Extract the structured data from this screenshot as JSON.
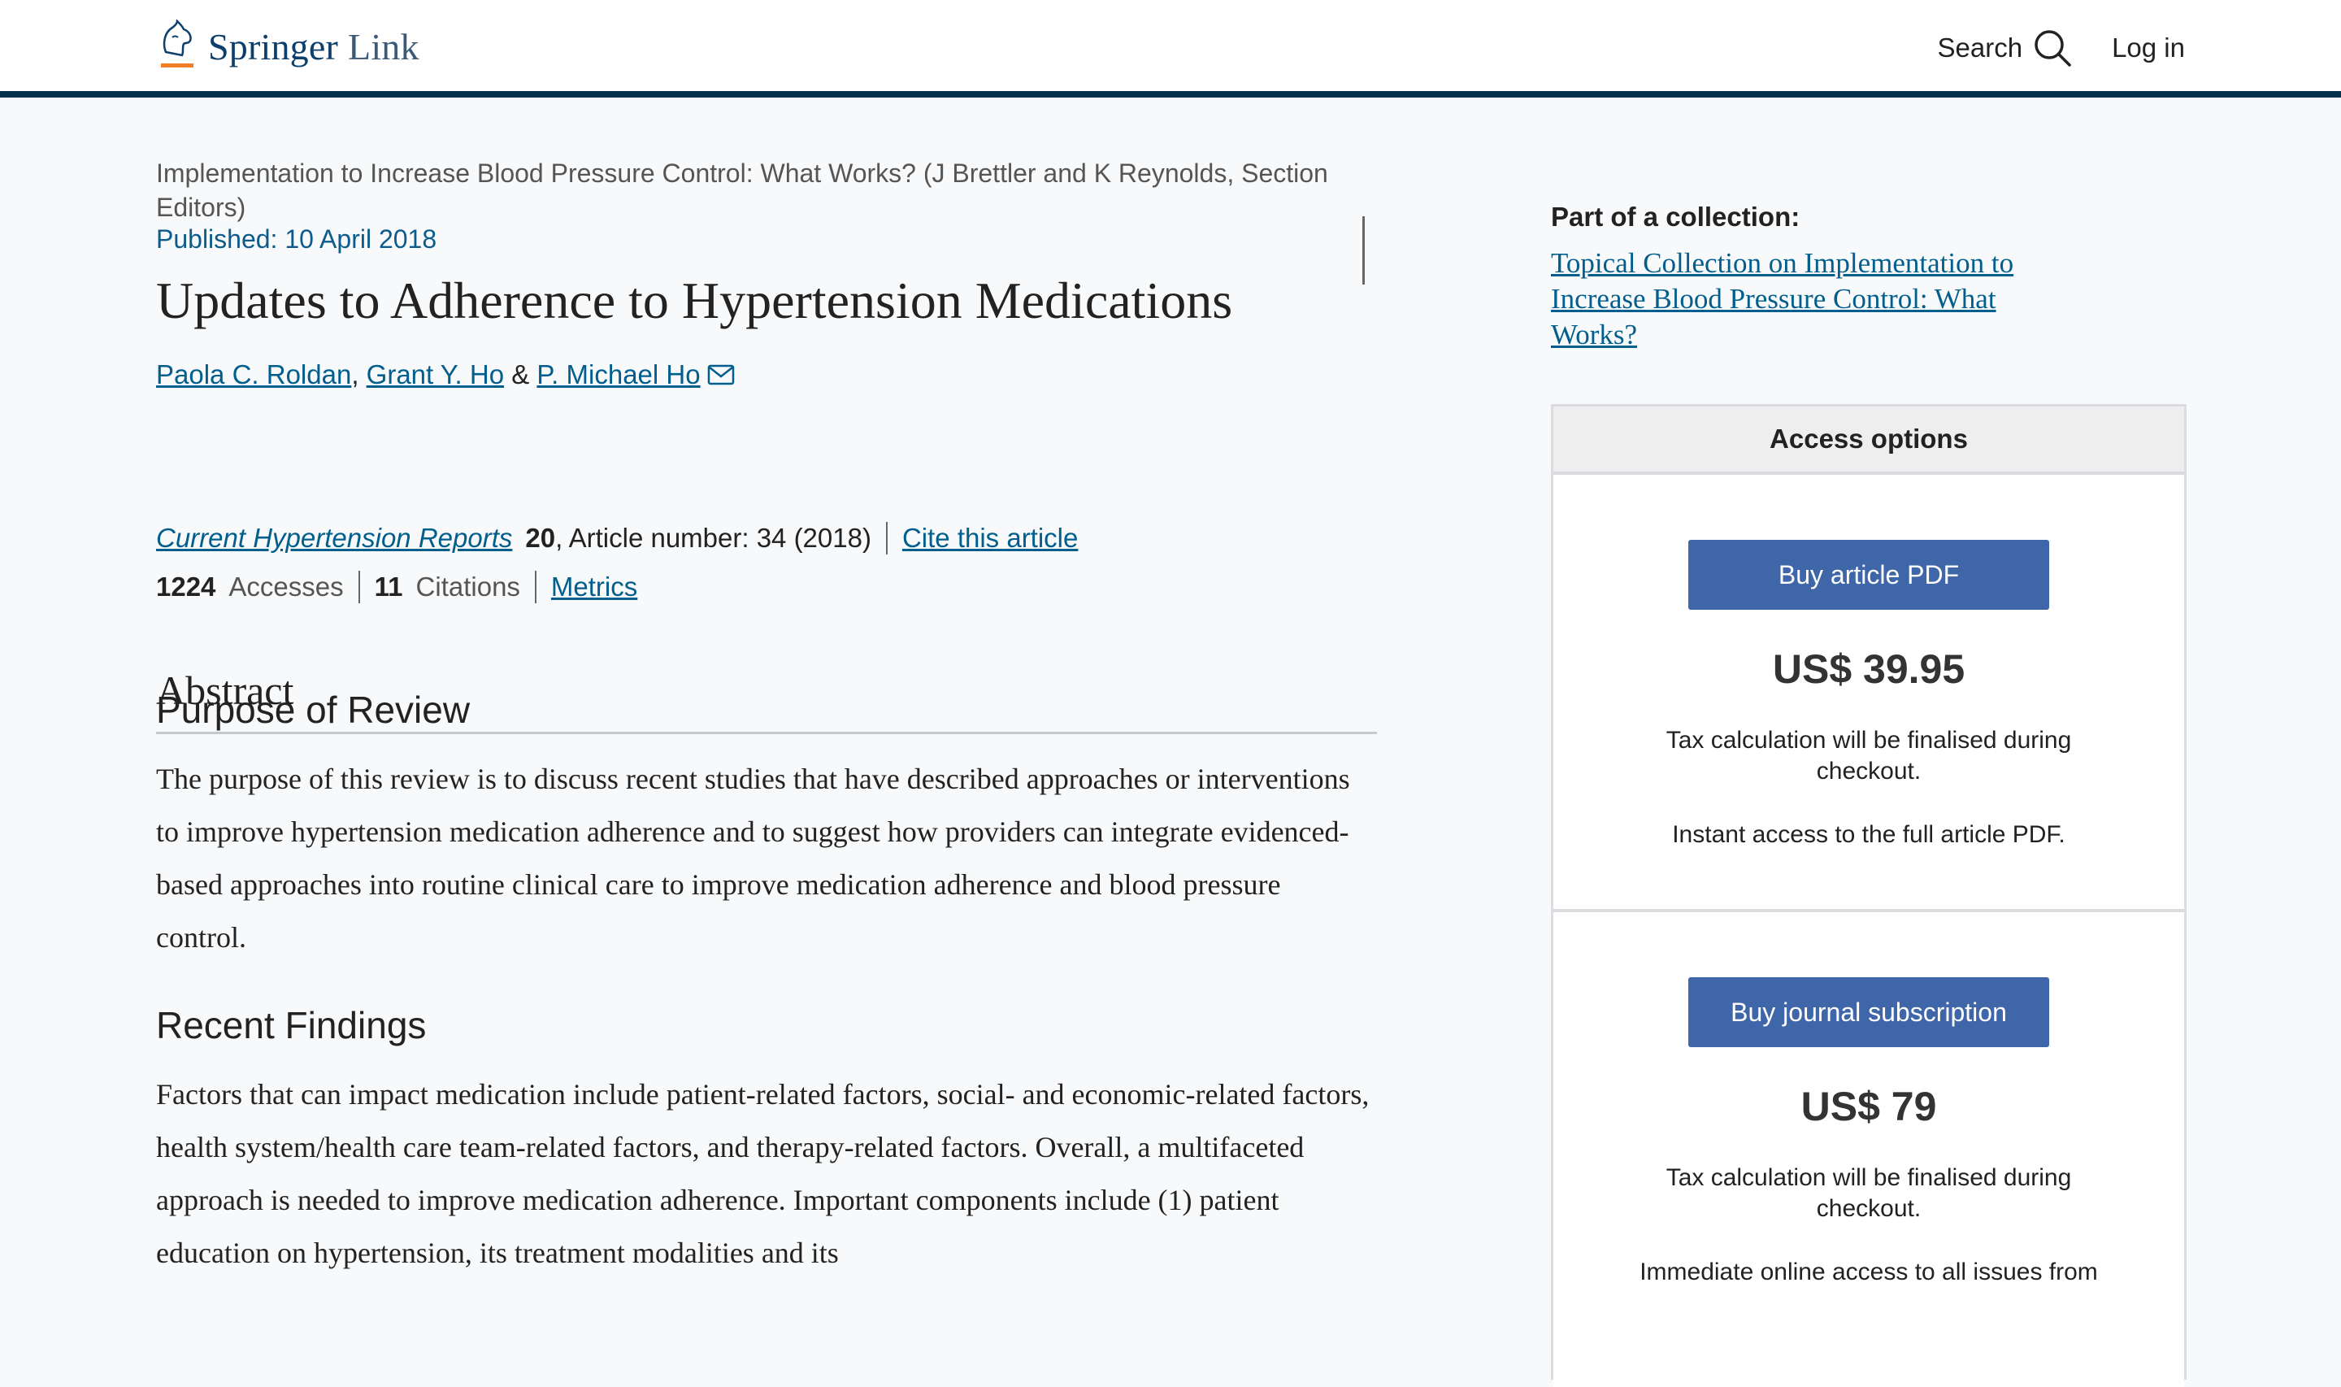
{
  "header": {
    "logo_brand": "Springer",
    "logo_product": "Link",
    "search_label": "Search",
    "login_label": "Log in"
  },
  "article": {
    "collection_line": "Implementation to Increase Blood Pressure Control: What Works? (J Brettler and K Reynolds, Section Editors)",
    "published": "Published: 10 April 2018",
    "title": "Updates to Adherence to Hypertension Medications",
    "authors": [
      {
        "name": "Paola C. Roldan"
      },
      {
        "name": "Grant Y. Ho"
      },
      {
        "name": "P. Michael Ho"
      }
    ],
    "author_sep_1": ",",
    "author_sep_2": "&",
    "journal": "Current Hypertension Reports",
    "volume": "20",
    "article_number": ", Article number: 34 (2018)",
    "cite_label": "Cite this article",
    "accesses_count": "1224",
    "accesses_label": "Accesses",
    "citations_count": "11",
    "citations_label": "Citations",
    "metrics_label": "Metrics"
  },
  "abstract": {
    "heading": "Abstract",
    "purpose_heading": "Purpose of Review",
    "purpose_text": "The purpose of this review is to discuss recent studies that have described approaches or interventions to improve hypertension medication adherence and to suggest how providers can integrate evidenced-based approaches into routine clinical care to improve medication adherence and blood pressure control.",
    "findings_heading": "Recent Findings",
    "findings_text": "Factors that can impact medication include patient-related factors, social- and economic-related factors, health system/health care team-related factors, and therapy-related factors. Overall, a multifaceted approach is needed to improve medication adherence. Important components include (1) patient education on hypertension, its treatment modalities and its"
  },
  "sidebar": {
    "collection_label": "Part of a collection:",
    "collection_link": "Topical Collection on Implementation to Increase Blood Pressure Control: What Works?",
    "access_heading": "Access options",
    "offers": [
      {
        "button": "Buy article PDF",
        "price": "US$ 39.95",
        "tax": "Tax calculation will be finalised during checkout.",
        "note": "Instant access to the full article PDF."
      },
      {
        "button": "Buy journal subscription",
        "price": "US$ 79",
        "tax": "Tax calculation will be finalised during checkout.",
        "note": "Immediate online access to all issues from"
      }
    ]
  },
  "colors": {
    "brand_dark": "#01324b",
    "link": "#025e8d",
    "button": "#3f66a8"
  }
}
